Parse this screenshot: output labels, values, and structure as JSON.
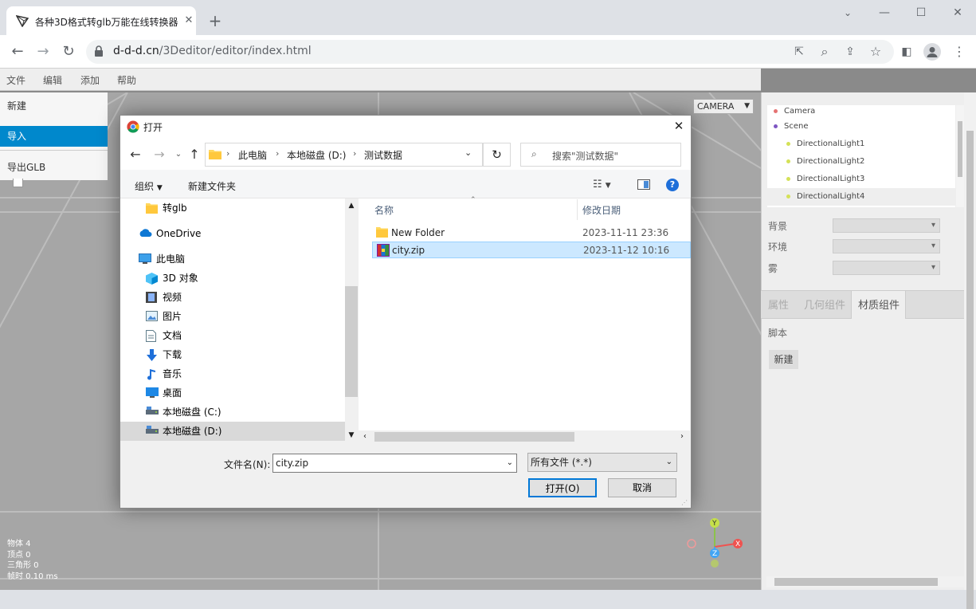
{
  "browser": {
    "tab_title": "各种3D格式转glb万能在线转换器",
    "url_host": "d-d-d.cn",
    "url_path": "/3Deditor/editor/index.html"
  },
  "menu": {
    "items": [
      "文件",
      "编辑",
      "添加",
      "帮助"
    ],
    "dropdown": [
      "新建",
      "导入",
      "导出GLB"
    ]
  },
  "viewport": {
    "camera_select": "CAMERA",
    "stats": {
      "objects": "物体 4",
      "vertices": "顶点 0",
      "triangles": "三角形 0",
      "frametime": "帧时 0.10 ms"
    }
  },
  "outliner": [
    {
      "name": "Camera",
      "color": "#e57373",
      "indent": 0
    },
    {
      "name": "Scene",
      "color": "#7e57c2",
      "indent": 0
    },
    {
      "name": "DirectionalLight1",
      "color": "#d4e157",
      "indent": 1
    },
    {
      "name": "DirectionalLight2",
      "color": "#d4e157",
      "indent": 1
    },
    {
      "name": "DirectionalLight3",
      "color": "#d4e157",
      "indent": 1
    },
    {
      "name": "DirectionalLight4",
      "color": "#d4e157",
      "indent": 1
    }
  ],
  "scene_props": {
    "background": "背景",
    "environment": "环境",
    "fog": "雾"
  },
  "panel_tabs": [
    "属性",
    "几何组件",
    "材质组件"
  ],
  "script": {
    "title": "脚本",
    "new_button": "新建"
  },
  "dialog": {
    "title": "打开",
    "breadcrumb": [
      "此电脑",
      "本地磁盘 (D:)",
      "测试数据"
    ],
    "search_placeholder": "搜索\"测试数据\"",
    "toolbar": {
      "organize": "组织",
      "new_folder": "新建文件夹"
    },
    "nav": [
      {
        "label": "转glb",
        "icon": "folder-icon",
        "indent": 1
      },
      {
        "label": "OneDrive",
        "icon": "onedrive-icon",
        "indent": 0
      },
      {
        "label": "此电脑",
        "icon": "computer-icon",
        "indent": 0
      },
      {
        "label": "3D 对象",
        "icon": "cube-icon",
        "indent": 1
      },
      {
        "label": "视频",
        "icon": "video-icon",
        "indent": 1
      },
      {
        "label": "图片",
        "icon": "picture-icon",
        "indent": 1
      },
      {
        "label": "文档",
        "icon": "document-icon",
        "indent": 1
      },
      {
        "label": "下载",
        "icon": "download-icon",
        "indent": 1
      },
      {
        "label": "音乐",
        "icon": "music-icon",
        "indent": 1
      },
      {
        "label": "桌面",
        "icon": "desktop-icon",
        "indent": 1
      },
      {
        "label": "本地磁盘 (C:)",
        "icon": "drive-icon",
        "indent": 1
      },
      {
        "label": "本地磁盘 (D:)",
        "icon": "drive-icon",
        "indent": 1,
        "selected": true
      }
    ],
    "columns": {
      "name": "名称",
      "modified": "修改日期"
    },
    "files": [
      {
        "name": "New Folder",
        "modified": "2023-11-11 23:36",
        "icon": "folder-icon"
      },
      {
        "name": "city.zip",
        "modified": "2023-11-12 10:16",
        "icon": "zip-icon",
        "selected": true
      }
    ],
    "filename_label": "文件名(N):",
    "filename_value": "city.zip",
    "filetype": "所有文件 (*.*)",
    "open_button": "打开(O)",
    "cancel_button": "取消"
  }
}
